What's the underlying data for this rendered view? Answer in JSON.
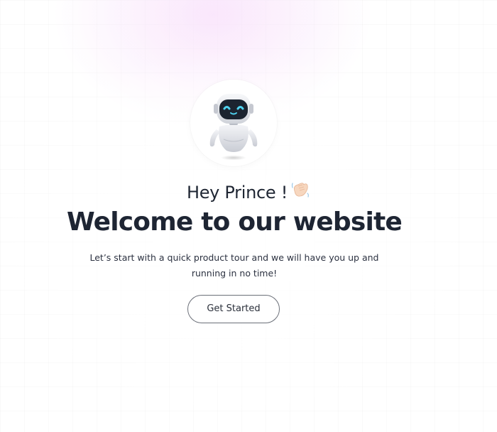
{
  "greeting": {
    "text": "Hey Prince !",
    "emoji_icon": "waving-hand-icon"
  },
  "headline": "Welcome to our website",
  "subtext": "Let’s start with a quick product tour and we will have you up and running in no time!",
  "cta": {
    "label": "Get Started"
  },
  "avatar": {
    "icon": "robot-icon",
    "eye_color": "#4fd3f0"
  },
  "colors": {
    "text_dark": "#1e2533",
    "glow_pink": "#f6d6fa",
    "button_border": "#6b6f78"
  }
}
